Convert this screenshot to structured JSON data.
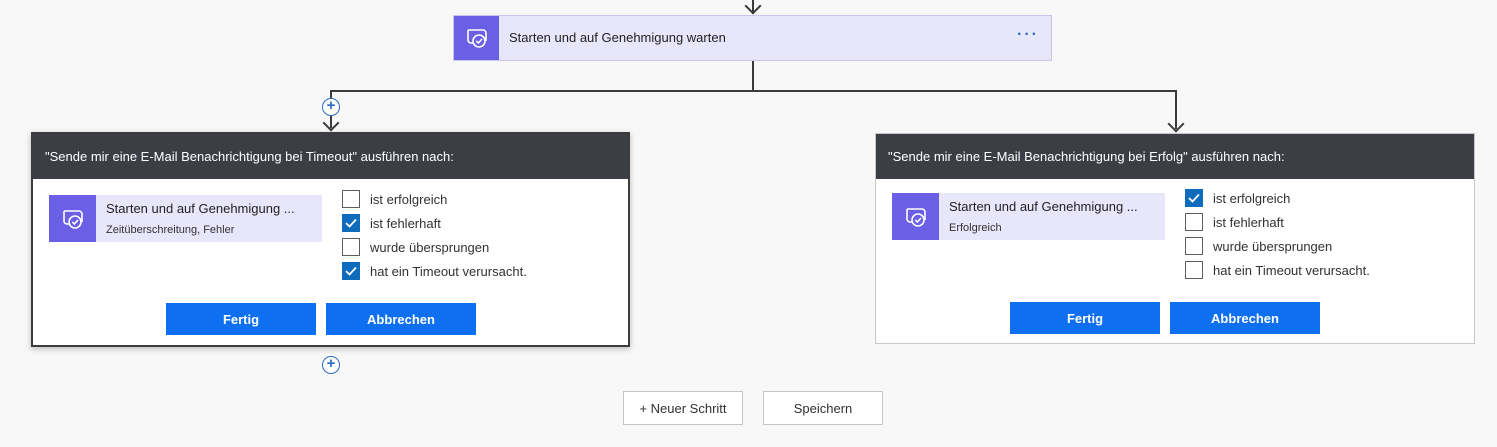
{
  "top_action": {
    "title": "Starten und auf Genehmigung warten",
    "more_label": "···"
  },
  "left_panel": {
    "header": "\"Sende mir eine E-Mail Benachrichtigung bei Timeout\" ausführen nach:",
    "action_name": "Starten und auf Genehmigung ...",
    "action_status": "Zeitüberschreitung, Fehler",
    "options": [
      {
        "label": "ist erfolgreich",
        "checked": false
      },
      {
        "label": "ist fehlerhaft",
        "checked": true
      },
      {
        "label": "wurde übersprungen",
        "checked": false
      },
      {
        "label": "hat ein Timeout verursacht.",
        "checked": true
      }
    ],
    "done_label": "Fertig",
    "cancel_label": "Abbrechen"
  },
  "right_panel": {
    "header": "\"Sende mir eine E-Mail Benachrichtigung bei Erfolg\" ausführen nach:",
    "action_name": "Starten und auf Genehmigung ...",
    "action_status": "Erfolgreich",
    "options": [
      {
        "label": "ist erfolgreich",
        "checked": true
      },
      {
        "label": "ist fehlerhaft",
        "checked": false
      },
      {
        "label": "wurde übersprungen",
        "checked": false
      },
      {
        "label": "hat ein Timeout verursacht.",
        "checked": false
      }
    ],
    "done_label": "Fertig",
    "cancel_label": "Abbrechen"
  },
  "footer": {
    "new_step_label": "+ Neuer Schritt",
    "save_label": "Speichern"
  },
  "icons": {
    "approval": "approval-icon",
    "add": "plus-circle-icon",
    "check": "checkmark-icon"
  },
  "colors": {
    "accent": "#0e6ff0",
    "approval_icon_bg": "#6b5fe6",
    "header_bg": "#3b3f45"
  }
}
